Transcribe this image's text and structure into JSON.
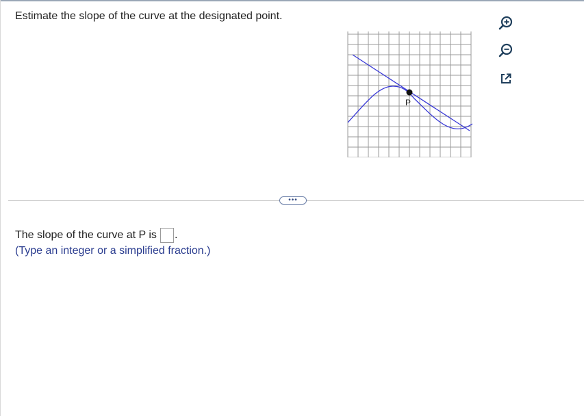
{
  "question": {
    "text": "Estimate the slope of the curve at the designated point."
  },
  "graph": {
    "point_label": "P",
    "curve_color": "#3838d6",
    "tangent_color": "#3838d6",
    "grid_color": "#9a9a9a"
  },
  "toolbar": {
    "icons": [
      "zoom-in-icon",
      "zoom-out-icon",
      "pop-out-icon"
    ],
    "icon_color": "#1f3f5c"
  },
  "divider": {
    "more_label": "•••"
  },
  "answer": {
    "prompt": "The slope of the curve at P is",
    "value": "",
    "suffix": "."
  },
  "hint": {
    "text": "(Type an integer or a simplified fraction.)",
    "color": "#2a3c8f"
  }
}
